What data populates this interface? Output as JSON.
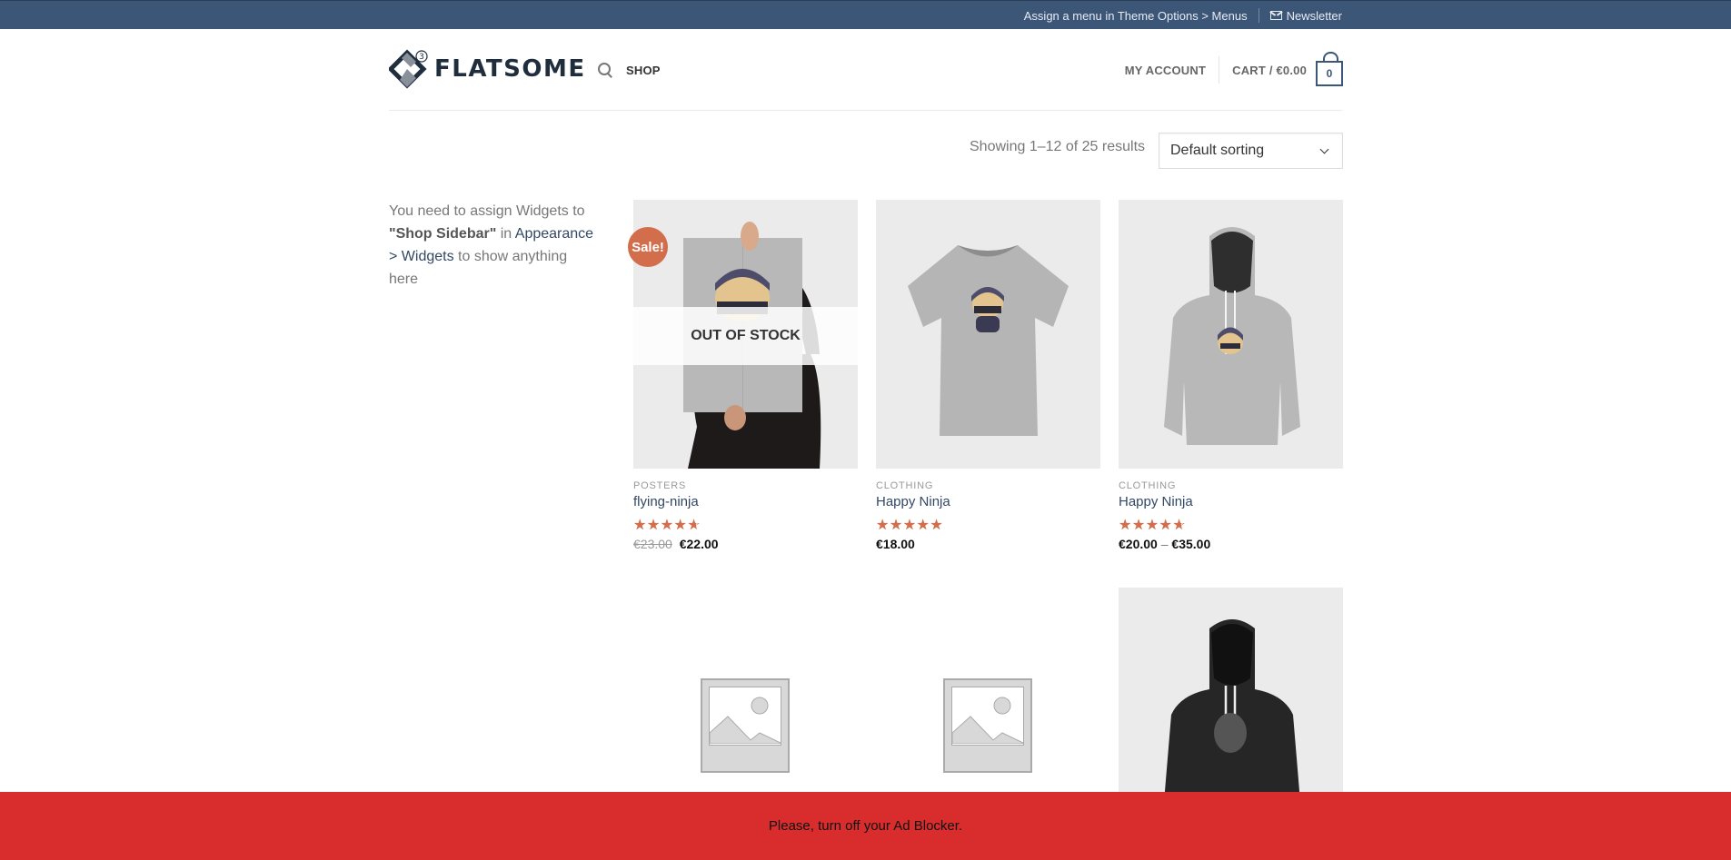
{
  "topbar": {
    "menu_notice": "Assign a menu in Theme Options > Menus",
    "newsletter_label": "Newsletter",
    "newsletter_icon": "envelope-icon",
    "background": "#3c5677"
  },
  "header": {
    "logo_text": "FLATSOME",
    "logo_badge": "3",
    "search_icon": "search-icon",
    "nav_left": [
      {
        "label": "SHOP"
      }
    ],
    "account_label": "MY ACCOUNT",
    "cart_label": "CART / €0.00",
    "cart_count": "0"
  },
  "toolbar": {
    "result_count": "Showing 1–12 of 25 results",
    "sort_selected": "Default sorting"
  },
  "sidebar": {
    "text_before": "You need to assign Widgets to ",
    "sidebar_name": "\"Shop Sidebar\"",
    "text_in": " in ",
    "link_text": "Appearance > Widgets",
    "text_after": " to show anything here"
  },
  "products": [
    {
      "category": "POSTERS",
      "title": "flying-ninja",
      "rating": 4.2,
      "regular_price": "€23.00",
      "price": "€22.00",
      "badge": "Sale!",
      "overlay": "OUT OF STOCK"
    },
    {
      "category": "CLOTHING",
      "title": "Happy Ninja",
      "rating": 5,
      "price": "€18.00"
    },
    {
      "category": "CLOTHING",
      "title": "Happy Ninja",
      "rating": 4.2,
      "price_min": "€20.00",
      "price_sep": "–",
      "price_max": "€35.00"
    }
  ],
  "stars_glyph": "★★★★★",
  "stars_empty_glyph": "☆☆☆☆☆",
  "adblock_message": "Please, turn off your Ad Blocker.",
  "colors": {
    "accent": "#d26e4b",
    "primary": "#3c5677",
    "adbar": "#d92d2d",
    "link": "#334862"
  }
}
